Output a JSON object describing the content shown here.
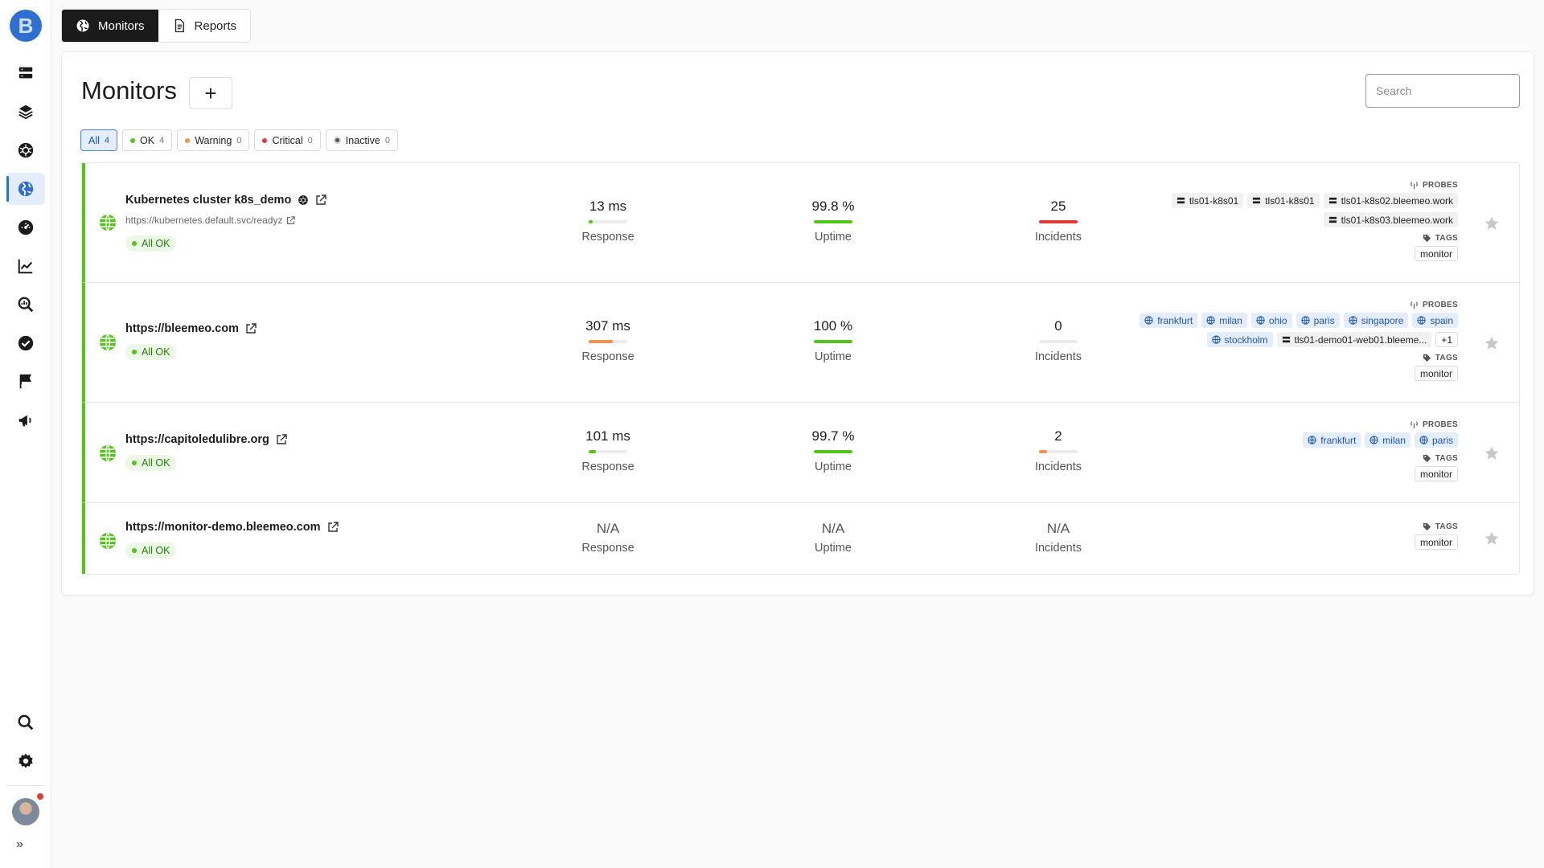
{
  "sidebar": {
    "logo": "B",
    "items": [
      {
        "name": "servers-icon"
      },
      {
        "name": "layers-icon"
      },
      {
        "name": "kubernetes-icon"
      },
      {
        "name": "globe-icon",
        "active": true
      },
      {
        "name": "gauge-icon"
      },
      {
        "name": "chart-icon"
      },
      {
        "name": "analytics-search-icon"
      },
      {
        "name": "check-circle-icon"
      },
      {
        "name": "flag-icon"
      },
      {
        "name": "megaphone-icon"
      }
    ],
    "bottom": [
      {
        "name": "search-icon"
      },
      {
        "name": "gear-icon"
      }
    ],
    "expand_label": "»"
  },
  "tabs": [
    {
      "label": "Monitors",
      "icon": "globe-icon",
      "active": true
    },
    {
      "label": "Reports",
      "icon": "document-icon",
      "active": false
    }
  ],
  "page": {
    "title": "Monitors",
    "add_label": "+",
    "search_placeholder": "Search"
  },
  "filters": [
    {
      "label": "All",
      "count": "4",
      "dot": null
    },
    {
      "label": "OK",
      "count": "4",
      "dot": "#52c41a"
    },
    {
      "label": "Warning",
      "count": "0",
      "dot": "#f5914b"
    },
    {
      "label": "Critical",
      "count": "0",
      "dot": "#e53935"
    },
    {
      "label": "Inactive",
      "count": "0",
      "dot": "inactive"
    }
  ],
  "colors": {
    "ok": "#52c41a",
    "warning": "#f5914b",
    "critical": "#e53935",
    "accent": "#2f6fd0"
  },
  "monitors": [
    {
      "name": "Kubernetes cluster k8s_demo",
      "has_k8s_icon": true,
      "url": "https://kubernetes.default.svc/readyz",
      "status": "All OK",
      "response": {
        "value": "13 ms",
        "label": "Response",
        "fill": 0.05,
        "color": "#52c41a"
      },
      "uptime": {
        "value": "99.8 %",
        "label": "Uptime",
        "fill": 1.0,
        "color": "#52c41a"
      },
      "incidents": {
        "value": "25",
        "label": "Incidents",
        "fill": 1.0,
        "color": "#e53935"
      },
      "probes_label": "PROBES",
      "probes": [
        {
          "label": "tls01-k8s01",
          "kind": "server"
        },
        {
          "label": "tls01-k8s01",
          "kind": "server"
        },
        {
          "label": "tls01-k8s02.bleemeo.work",
          "kind": "server"
        },
        {
          "label": "tls01-k8s03.bleemeo.work",
          "kind": "server"
        }
      ],
      "tags_label": "TAGS",
      "tags": [
        "monitor"
      ]
    },
    {
      "name": "https://bleemeo.com",
      "has_k8s_icon": false,
      "url": null,
      "status": "All OK",
      "response": {
        "value": "307 ms",
        "label": "Response",
        "fill": 0.62,
        "color": "#f5914b"
      },
      "uptime": {
        "value": "100 %",
        "label": "Uptime",
        "fill": 1.0,
        "color": "#52c41a"
      },
      "incidents": {
        "value": "0",
        "label": "Incidents",
        "fill": 0,
        "color": "#ececec"
      },
      "probes_label": "PROBES",
      "probes": [
        {
          "label": "frankfurt",
          "kind": "location"
        },
        {
          "label": "milan",
          "kind": "location"
        },
        {
          "label": "ohio",
          "kind": "location"
        },
        {
          "label": "paris",
          "kind": "location"
        },
        {
          "label": "singapore",
          "kind": "location"
        },
        {
          "label": "spain",
          "kind": "location"
        },
        {
          "label": "stockholm",
          "kind": "location"
        },
        {
          "label": "tls01-demo01-web01.bleeme...",
          "kind": "server"
        },
        {
          "label": "+1",
          "kind": "more"
        }
      ],
      "tags_label": "TAGS",
      "tags": [
        "monitor"
      ]
    },
    {
      "name": "https://capitoledulibre.org",
      "has_k8s_icon": false,
      "url": null,
      "status": "All OK",
      "response": {
        "value": "101 ms",
        "label": "Response",
        "fill": 0.18,
        "color": "#52c41a"
      },
      "uptime": {
        "value": "99.7 %",
        "label": "Uptime",
        "fill": 1.0,
        "color": "#52c41a"
      },
      "incidents": {
        "value": "2",
        "label": "Incidents",
        "fill": 0.2,
        "color": "#f5914b"
      },
      "probes_label": "PROBES",
      "probes": [
        {
          "label": "frankfurt",
          "kind": "location"
        },
        {
          "label": "milan",
          "kind": "location"
        },
        {
          "label": "paris",
          "kind": "location"
        }
      ],
      "tags_label": "TAGS",
      "tags": [
        "monitor"
      ]
    },
    {
      "name": "https://monitor-demo.bleemeo.com",
      "has_k8s_icon": false,
      "url": null,
      "status": "All OK",
      "response": {
        "value": "N/A",
        "label": "Response",
        "fill": null,
        "color": null
      },
      "uptime": {
        "value": "N/A",
        "label": "Uptime",
        "fill": null,
        "color": null
      },
      "incidents": {
        "value": "N/A",
        "label": "Incidents",
        "fill": null,
        "color": null
      },
      "probes_label": null,
      "probes": [],
      "tags_label": "TAGS",
      "tags": [
        "monitor"
      ]
    }
  ]
}
